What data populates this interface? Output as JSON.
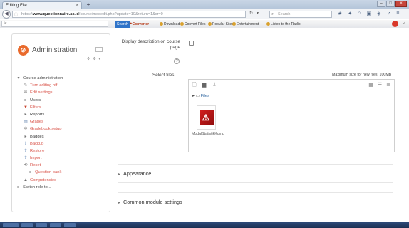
{
  "browser": {
    "tab_title": "Editing File",
    "tab_close": "×",
    "new_tab": "+",
    "win_min": "–",
    "win_max": "□",
    "win_close": "×",
    "url_prefix": "https://",
    "url_host": "www.questionnaire.ac.id",
    "url_rest": "/course/modedit.php?update=10&return=1&sr=0",
    "search_placeholder": "Search",
    "bookmarks": {
      "search": "Search",
      "converter": "Converter",
      "download": "Download",
      "convert_files": "Convert Files",
      "popular": "Popular Sites",
      "entertainment": "Entertainment",
      "radio": "Listen to the Radio"
    }
  },
  "admin": {
    "title": "Administration",
    "block_controls": "✣ ✥ ▾",
    "items": [
      {
        "label": "Course administration",
        "level": 0,
        "glyph": "▾"
      },
      {
        "label": "Turn editing off",
        "level": 1,
        "glyph": "✎"
      },
      {
        "label": "Edit settings",
        "level": 1,
        "glyph": "✲"
      },
      {
        "label": "Users",
        "level": 1,
        "glyph": "▸"
      },
      {
        "label": "Filters",
        "level": 1,
        "glyph": "▼"
      },
      {
        "label": "Reports",
        "level": 1,
        "glyph": "▸"
      },
      {
        "label": "Grades",
        "level": 1,
        "glyph": "▤"
      },
      {
        "label": "Gradebook setup",
        "level": 1,
        "glyph": "✲"
      },
      {
        "label": "Badges",
        "level": 1,
        "glyph": "▸"
      },
      {
        "label": "Backup",
        "level": 1,
        "glyph": "⇧"
      },
      {
        "label": "Restore",
        "level": 1,
        "glyph": "⇧"
      },
      {
        "label": "Import",
        "level": 1,
        "glyph": "⇧"
      },
      {
        "label": "Reset",
        "level": 1,
        "glyph": "⟲"
      },
      {
        "label": "Question bank",
        "level": 2,
        "glyph": "▸"
      },
      {
        "label": "Competencies",
        "level": 1,
        "glyph": "▲"
      },
      {
        "label": "Switch role to...",
        "level": 0,
        "glyph": "▸"
      }
    ]
  },
  "form": {
    "display_desc_label": "Display description on course page",
    "help": "?",
    "select_files_label": "Select files",
    "max_size": "Maximum size for new files: 100MB",
    "files_path": "Files",
    "file_name": "ModulStatistikKomp",
    "section_appearance": "Appearance",
    "section_common": "Common module settings"
  },
  "icons": {
    "add_file": "file-add-icon",
    "create_folder": "folder-icon",
    "download_all": "download-icon",
    "view_icons": "grid-view-icon",
    "view_details": "details-view-icon",
    "view_tree": "tree-view-icon"
  }
}
